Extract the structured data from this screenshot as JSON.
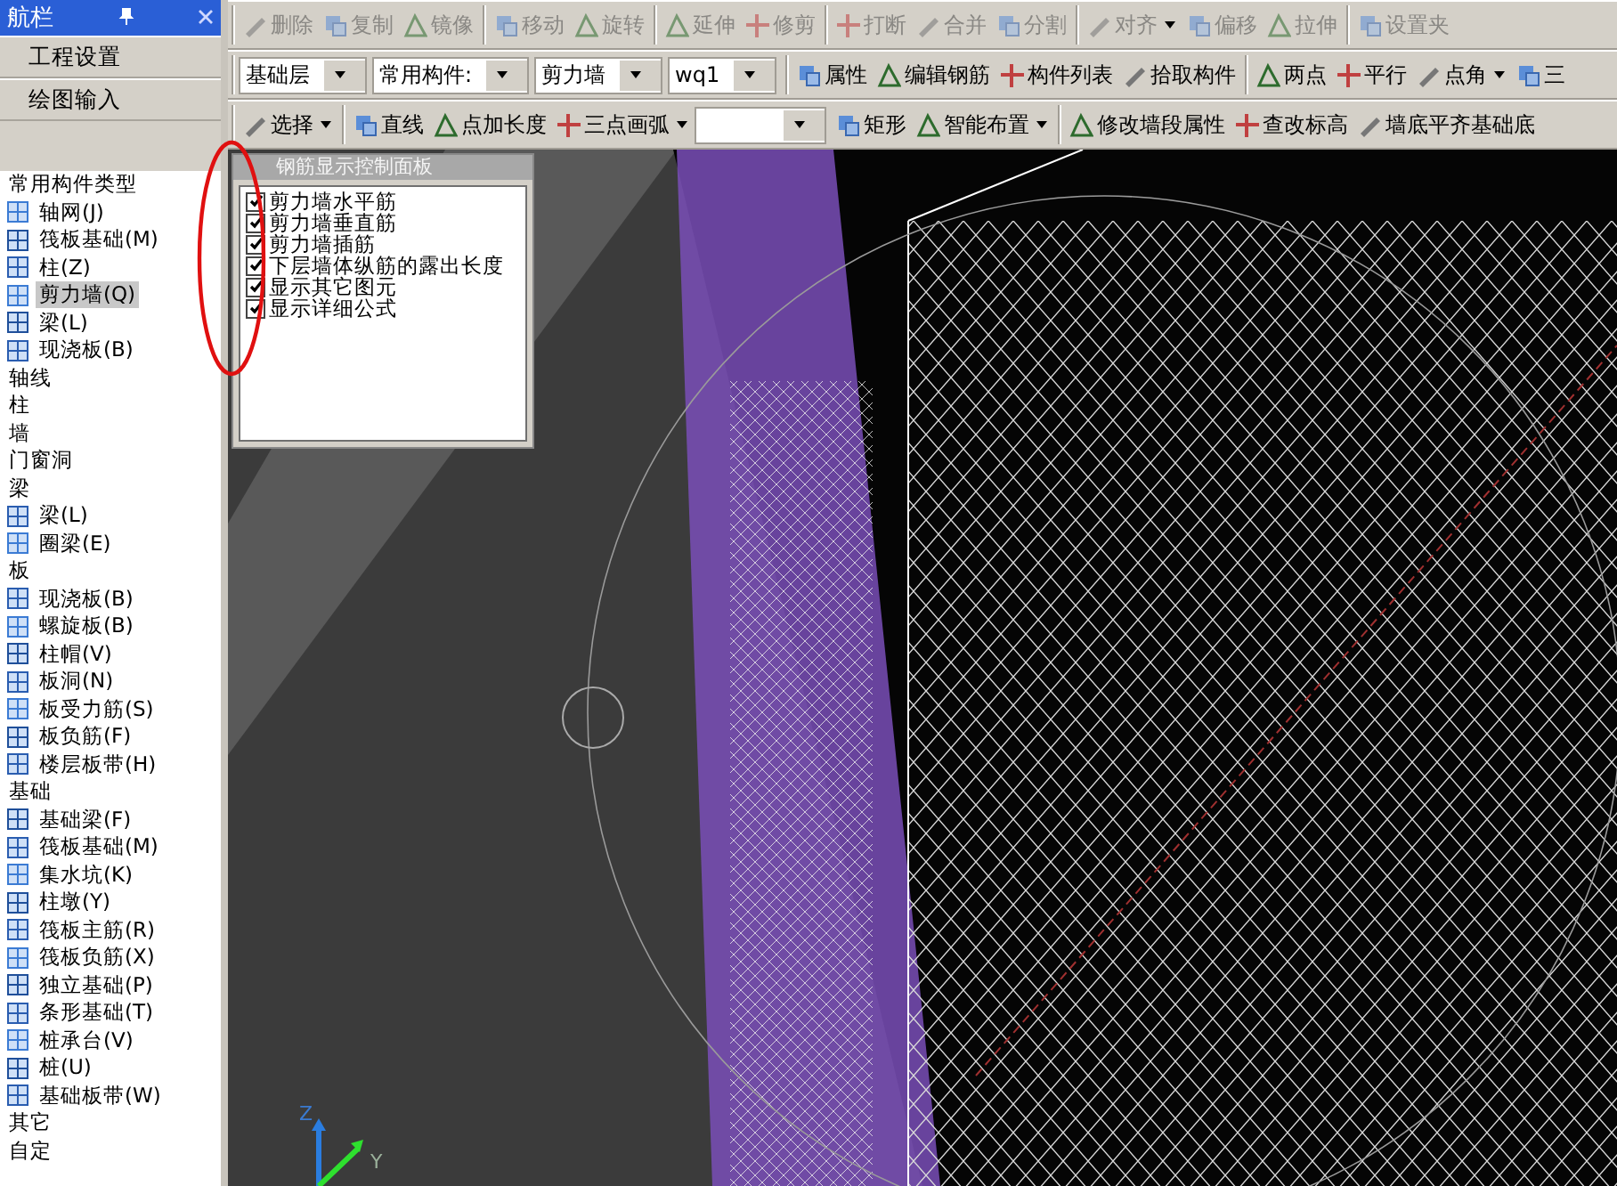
{
  "navigator": {
    "title": "航栏",
    "buttons": [
      "工程设置",
      "绘图输入"
    ]
  },
  "tree": [
    {
      "label": "常用构件类型",
      "kind": "header",
      "selected": false
    },
    {
      "label": "轴网(J)",
      "kind": "item",
      "selected": false
    },
    {
      "label": "筏板基础(M)",
      "kind": "item",
      "selected": false
    },
    {
      "label": "柱(Z)",
      "kind": "item",
      "selected": false
    },
    {
      "label": "剪力墙(Q)",
      "kind": "item",
      "selected": true
    },
    {
      "label": "梁(L)",
      "kind": "item",
      "selected": false
    },
    {
      "label": "现浇板(B)",
      "kind": "item",
      "selected": false
    },
    {
      "label": "轴线",
      "kind": "header",
      "selected": false
    },
    {
      "label": "柱",
      "kind": "header",
      "selected": false
    },
    {
      "label": "墙",
      "kind": "header",
      "selected": false
    },
    {
      "label": "门窗洞",
      "kind": "header",
      "selected": false
    },
    {
      "label": "梁",
      "kind": "header",
      "selected": false
    },
    {
      "label": "梁(L)",
      "kind": "item",
      "selected": false
    },
    {
      "label": "圈梁(E)",
      "kind": "item",
      "selected": false
    },
    {
      "label": "板",
      "kind": "header",
      "selected": false
    },
    {
      "label": "现浇板(B)",
      "kind": "item",
      "selected": false
    },
    {
      "label": "螺旋板(B)",
      "kind": "item",
      "selected": false
    },
    {
      "label": "柱帽(V)",
      "kind": "item",
      "selected": false
    },
    {
      "label": "板洞(N)",
      "kind": "item",
      "selected": false
    },
    {
      "label": "板受力筋(S)",
      "kind": "item",
      "selected": false
    },
    {
      "label": "板负筋(F)",
      "kind": "item",
      "selected": false
    },
    {
      "label": "楼层板带(H)",
      "kind": "item",
      "selected": false
    },
    {
      "label": "基础",
      "kind": "header",
      "selected": false
    },
    {
      "label": "基础梁(F)",
      "kind": "item",
      "selected": false
    },
    {
      "label": "筏板基础(M)",
      "kind": "item",
      "selected": false
    },
    {
      "label": "集水坑(K)",
      "kind": "item",
      "selected": false
    },
    {
      "label": "柱墩(Y)",
      "kind": "item",
      "selected": false
    },
    {
      "label": "筏板主筋(R)",
      "kind": "item",
      "selected": false
    },
    {
      "label": "筏板负筋(X)",
      "kind": "item",
      "selected": false
    },
    {
      "label": "独立基础(P)",
      "kind": "item",
      "selected": false
    },
    {
      "label": "条形基础(T)",
      "kind": "item",
      "selected": false
    },
    {
      "label": "桩承台(V)",
      "kind": "item",
      "selected": false
    },
    {
      "label": "桩(U)",
      "kind": "item",
      "selected": false
    },
    {
      "label": "基础板带(W)",
      "kind": "item",
      "selected": false
    },
    {
      "label": "其它",
      "kind": "header",
      "selected": false
    },
    {
      "label": "自定",
      "kind": "header",
      "selected": false
    }
  ],
  "toolbars": [
    [
      [
        {
          "kind": "button",
          "label": "删除",
          "dropdown": false,
          "disabled": true
        },
        {
          "kind": "button",
          "label": "复制",
          "dropdown": false,
          "disabled": true
        },
        {
          "kind": "button",
          "label": "镜像",
          "dropdown": false,
          "disabled": true
        }
      ],
      [
        {
          "kind": "button",
          "label": "移动",
          "dropdown": false,
          "disabled": true
        },
        {
          "kind": "button",
          "label": "旋转",
          "dropdown": false,
          "disabled": true
        }
      ],
      [
        {
          "kind": "button",
          "label": "延伸",
          "dropdown": false,
          "disabled": true
        },
        {
          "kind": "button",
          "label": "修剪",
          "dropdown": false,
          "disabled": true
        }
      ],
      [
        {
          "kind": "button",
          "label": "打断",
          "dropdown": false,
          "disabled": true
        },
        {
          "kind": "button",
          "label": "合并",
          "dropdown": false,
          "disabled": true
        },
        {
          "kind": "button",
          "label": "分割",
          "dropdown": false,
          "disabled": true
        }
      ],
      [
        {
          "kind": "button",
          "label": "对齐",
          "dropdown": true,
          "disabled": true
        },
        {
          "kind": "button",
          "label": "偏移",
          "dropdown": false,
          "disabled": true
        },
        {
          "kind": "button",
          "label": "拉伸",
          "dropdown": false,
          "disabled": true
        }
      ],
      [
        {
          "kind": "button",
          "label": "设置夹",
          "dropdown": false,
          "disabled": true
        }
      ]
    ],
    [
      [
        {
          "kind": "combo",
          "label": "基础层"
        },
        {
          "kind": "combo",
          "label": "常用构件:"
        },
        {
          "kind": "combo",
          "label": "剪力墙"
        },
        {
          "kind": "combo",
          "label": "wq1"
        }
      ],
      [
        {
          "kind": "button",
          "label": "属性",
          "dropdown": false,
          "disabled": false
        },
        {
          "kind": "button",
          "label": "编辑钢筋",
          "dropdown": false,
          "disabled": false
        },
        {
          "kind": "button",
          "label": "构件列表",
          "dropdown": false,
          "disabled": false
        },
        {
          "kind": "button",
          "label": "拾取构件",
          "dropdown": false,
          "disabled": false
        }
      ],
      [
        {
          "kind": "button",
          "label": "两点",
          "dropdown": false,
          "disabled": false
        },
        {
          "kind": "button",
          "label": "平行",
          "dropdown": false,
          "disabled": false
        },
        {
          "kind": "button",
          "label": "点角",
          "dropdown": true,
          "disabled": false
        },
        {
          "kind": "button",
          "label": "三",
          "dropdown": false,
          "disabled": false
        }
      ]
    ],
    [
      [
        {
          "kind": "button",
          "label": "选择",
          "dropdown": true,
          "disabled": false
        }
      ],
      [
        {
          "kind": "button",
          "label": "直线",
          "dropdown": false,
          "disabled": false
        },
        {
          "kind": "button",
          "label": "点加长度",
          "dropdown": false,
          "disabled": false
        },
        {
          "kind": "button",
          "label": "三点画弧",
          "dropdown": true,
          "disabled": false
        },
        {
          "kind": "combo"
        },
        {
          "kind": "button",
          "label": "矩形",
          "dropdown": false,
          "disabled": false
        },
        {
          "kind": "button",
          "label": "智能布置",
          "dropdown": true,
          "disabled": false
        }
      ],
      [
        {
          "kind": "button",
          "label": "修改墙段属性",
          "dropdown": false,
          "disabled": false
        },
        {
          "kind": "button",
          "label": "查改标高",
          "dropdown": false,
          "disabled": false
        },
        {
          "kind": "button",
          "label": "墙底平齐基础底",
          "dropdown": false,
          "disabled": false
        }
      ]
    ]
  ],
  "rebar_panel": {
    "title": "钢筋显示控制面板",
    "options": [
      {
        "label": "剪力墙水平筋",
        "checked": true
      },
      {
        "label": "剪力墙垂直筋",
        "checked": true
      },
      {
        "label": "剪力墙插筋",
        "checked": true
      },
      {
        "label": "下层墙体纵筋的露出长度",
        "checked": true
      },
      {
        "label": "显示其它图元",
        "checked": true
      },
      {
        "label": "显示详细公式",
        "checked": true
      }
    ]
  },
  "axes": [
    "Z",
    "Y"
  ]
}
